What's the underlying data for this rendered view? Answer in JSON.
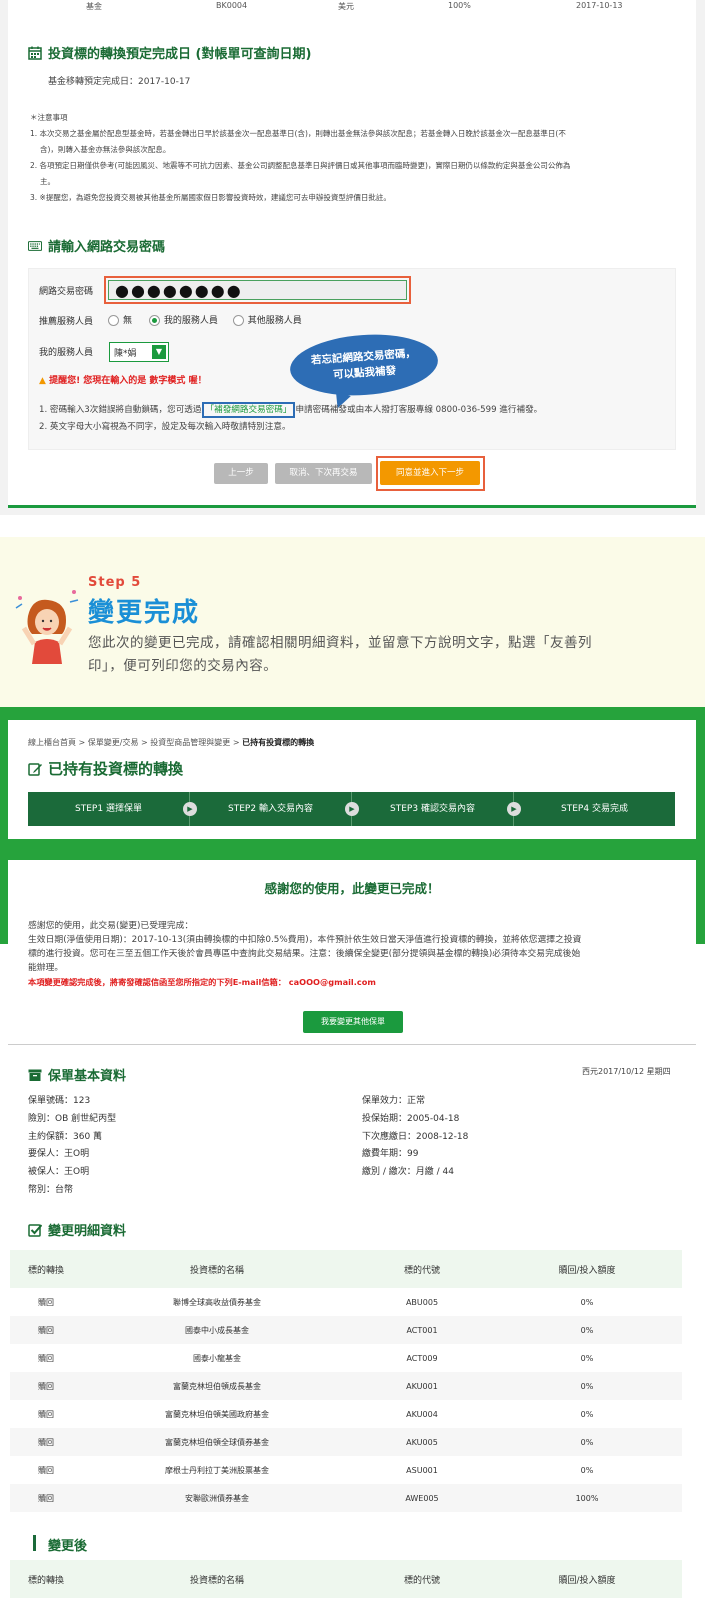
{
  "top_row": {
    "c1": "基金",
    "c2": "BK0004",
    "c3": "美元",
    "c4": "100%",
    "c5": "2017-10-13"
  },
  "schedule": {
    "title": "投資標的轉換預定完成日 (對帳單可查詢日期)",
    "line": "基金移轉預定完成日：2017-10-17"
  },
  "notes": {
    "head": "＊注意事項",
    "n1": "1. 本次交易之基金屬於配息型基金時，若基金轉出日早於該基金次一配息基準日(含)，則轉出基金無法參與該次配息；若基金轉入日晚於該基金次一配息基準日(不",
    "n1b": "含)，則轉入基金亦無法參與該次配息。",
    "n2": "2. 各項預定日期僅供參考(可能因風災、地震等不可抗力因素、基金公司調整配息基準日與評價日或其他事項而臨時變更)，實際日期仍以條款約定與基金公司公佈為",
    "n2b": "主。",
    "n3": "3. ※提醒您，為避免您投資交易被其他基金所屬國家假日影響投資時效，建議您可去申辦投資型評價日批註。"
  },
  "password": {
    "title": "請輸入網路交易密碼",
    "label": "網路交易密碼",
    "value": "●●●●●●●●",
    "referral_label": "推薦服務人員",
    "opt_none": "無",
    "opt_mine": "我的服務人員",
    "opt_other": "其他服務人員",
    "my_agent_label": "我的服務人員",
    "agent_value": "陳*娟",
    "warn": "提醒您! 您現在輸入的是 數字模式 喔！",
    "bubble1": "若忘記網路交易密碼，",
    "bubble2": "可以點我補發",
    "tip1a": "1. 密碼輸入3次錯誤將自動鎖碼，您可透過",
    "tip1link": "「補發網路交易密碼」",
    "tip1b": "申請密碼補發或由本人撥打客服專線 0800-036-599 進行補發。",
    "tip2": "2. 英文字母大小寫視為不同字，設定及每次輸入時敬請特別注意。"
  },
  "buttons": {
    "prev": "上一步",
    "cancel": "取消、下次再交易",
    "agree": "同意並進入下一步"
  },
  "step5": {
    "label": "Step 5",
    "title": "變更完成",
    "desc1": "您此次的變更已完成，請確認相關明細資料，並留意下方說明文字，點選「友善列",
    "desc2": "印」，便可列印您的交易內容。"
  },
  "breadcrumb": {
    "b1": "線上櫃台首頁",
    "sep": ">",
    "b2": "保單變更/交易",
    "b3": "投資型商品管理與變更",
    "b4": "已持有投資標的轉換"
  },
  "page_title": "已持有投資標的轉換",
  "steps": [
    "STEP1 選擇保單",
    "STEP2 輸入交易內容",
    "STEP3 確認交易內容",
    "STEP4 交易完成"
  ],
  "complete": {
    "thanks": "感謝您的使用，此變更已完成！",
    "p1": "感謝您的使用，此交易(變更)已受理完成：",
    "p2": "生效日期(淨值使用日期)：2017-10-13(須由轉換標的中扣除0.5%費用)，本件預計依生效日當天淨值進行投資標的轉換，並將依您選擇之投資",
    "p3": "標的進行投資。您可在三至五個工作天後於會員專區中查詢此交易結果。注意：後續保全變更(部分提領與基金標的轉換)必須待本交易完成後始",
    "p4": "能辦理。",
    "red": "本項變更確認完成後，將寄發確認信函至您所指定的下列E-mail信箱： caOOO@gmail.com",
    "button": "我要變更其他保單"
  },
  "policy": {
    "title": "保單基本資料",
    "date": "西元2017/10/12 星期四",
    "left": [
      "保單號碼：123",
      "險別：OB 創世紀丙型",
      "主約保額：360 萬",
      "要保人：王O明",
      "被保人：王O明",
      "幣別：台幣"
    ],
    "right": [
      "保單效力：正常",
      "投保始期：2005-04-18",
      "下次應繳日：2008-12-18",
      "繳費年期：99",
      "繳別 / 繳次：月繳 / 44"
    ]
  },
  "detail": {
    "title": "變更明細資料",
    "headers": [
      "標的轉換",
      "投資標的名稱",
      "標的代號",
      "贖回/投入額度"
    ],
    "rows": [
      [
        "贖回",
        "聯博全球高收益債券基金",
        "ABU005",
        "0%"
      ],
      [
        "贖回",
        "國泰中小成長基金",
        "ACT001",
        "0%"
      ],
      [
        "贖回",
        "國泰小龍基金",
        "ACT009",
        "0%"
      ],
      [
        "贖回",
        "富蘭克林坦伯頓成長基金",
        "AKU001",
        "0%"
      ],
      [
        "贖回",
        "富蘭克林坦伯頓美國政府基金",
        "AKU004",
        "0%"
      ],
      [
        "贖回",
        "富蘭克林坦伯頓全球債券基金",
        "AKU005",
        "0%"
      ],
      [
        "贖回",
        "摩根士丹利拉丁美洲股票基金",
        "ASU001",
        "0%"
      ],
      [
        "贖回",
        "安聯歐洲債券基金",
        "AWE005",
        "100%"
      ]
    ]
  },
  "after": {
    "title": "變更後",
    "headers": [
      "標的轉換",
      "投資標的名稱",
      "標的代號",
      "贖回/投入額度"
    ]
  },
  "colors": {
    "green": "#1b9a3e",
    "dark_green": "#1b6a3a",
    "orange": "#f39800",
    "red": "#e02020",
    "blue": "#2d6db5"
  }
}
